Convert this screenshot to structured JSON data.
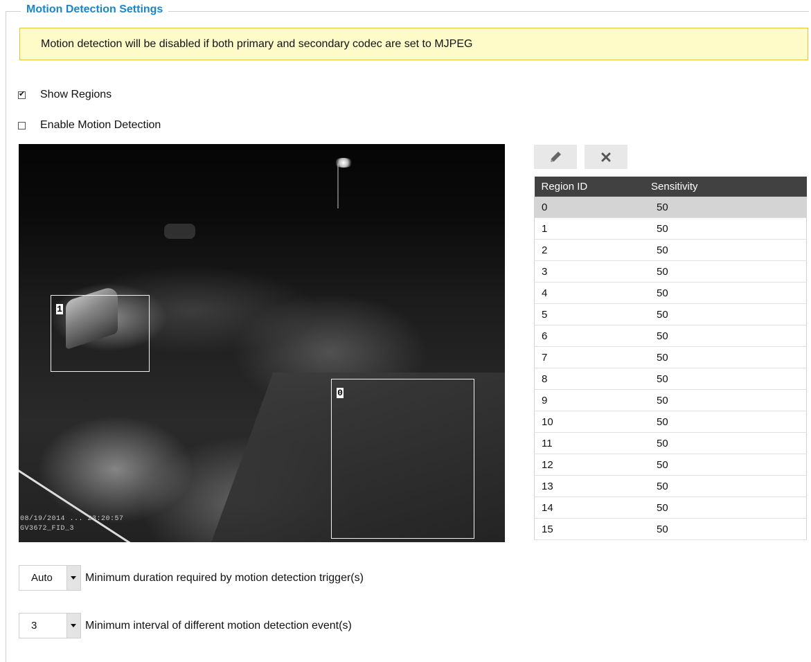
{
  "section": {
    "title": "Motion Detection Settings"
  },
  "notice": {
    "text": "Motion detection will be disabled if both primary and secondary codec are set to MJPEG"
  },
  "options": {
    "show_regions": {
      "label": "Show Regions",
      "checked": true
    },
    "enable_motion": {
      "label": "Enable Motion Detection",
      "checked": false
    }
  },
  "camera": {
    "osd_line1": "08/19/2014 ... 23:20:57",
    "osd_line2": "GV3672_FID_3",
    "regions": [
      {
        "id": "1"
      },
      {
        "id": "0"
      }
    ]
  },
  "toolbar": {
    "edit_icon": "pencil-icon",
    "delete_icon": "close-icon"
  },
  "table": {
    "headers": {
      "id": "Region ID",
      "sensitivity": "Sensitivity"
    },
    "selected_row": 0,
    "rows": [
      {
        "id": "0",
        "sensitivity": "50"
      },
      {
        "id": "1",
        "sensitivity": "50"
      },
      {
        "id": "2",
        "sensitivity": "50"
      },
      {
        "id": "3",
        "sensitivity": "50"
      },
      {
        "id": "4",
        "sensitivity": "50"
      },
      {
        "id": "5",
        "sensitivity": "50"
      },
      {
        "id": "6",
        "sensitivity": "50"
      },
      {
        "id": "7",
        "sensitivity": "50"
      },
      {
        "id": "8",
        "sensitivity": "50"
      },
      {
        "id": "9",
        "sensitivity": "50"
      },
      {
        "id": "10",
        "sensitivity": "50"
      },
      {
        "id": "11",
        "sensitivity": "50"
      },
      {
        "id": "12",
        "sensitivity": "50"
      },
      {
        "id": "13",
        "sensitivity": "50"
      },
      {
        "id": "14",
        "sensitivity": "50"
      },
      {
        "id": "15",
        "sensitivity": "50"
      }
    ]
  },
  "settings": {
    "min_duration": {
      "value": "Auto",
      "label": "Minimum duration required by motion detection trigger(s)"
    },
    "min_interval": {
      "value": "3",
      "label": "Minimum interval of different motion detection event(s)"
    }
  },
  "colors": {
    "legend": "#1a86c8",
    "notice_bg": "#fffbc8",
    "table_header": "#414141"
  }
}
